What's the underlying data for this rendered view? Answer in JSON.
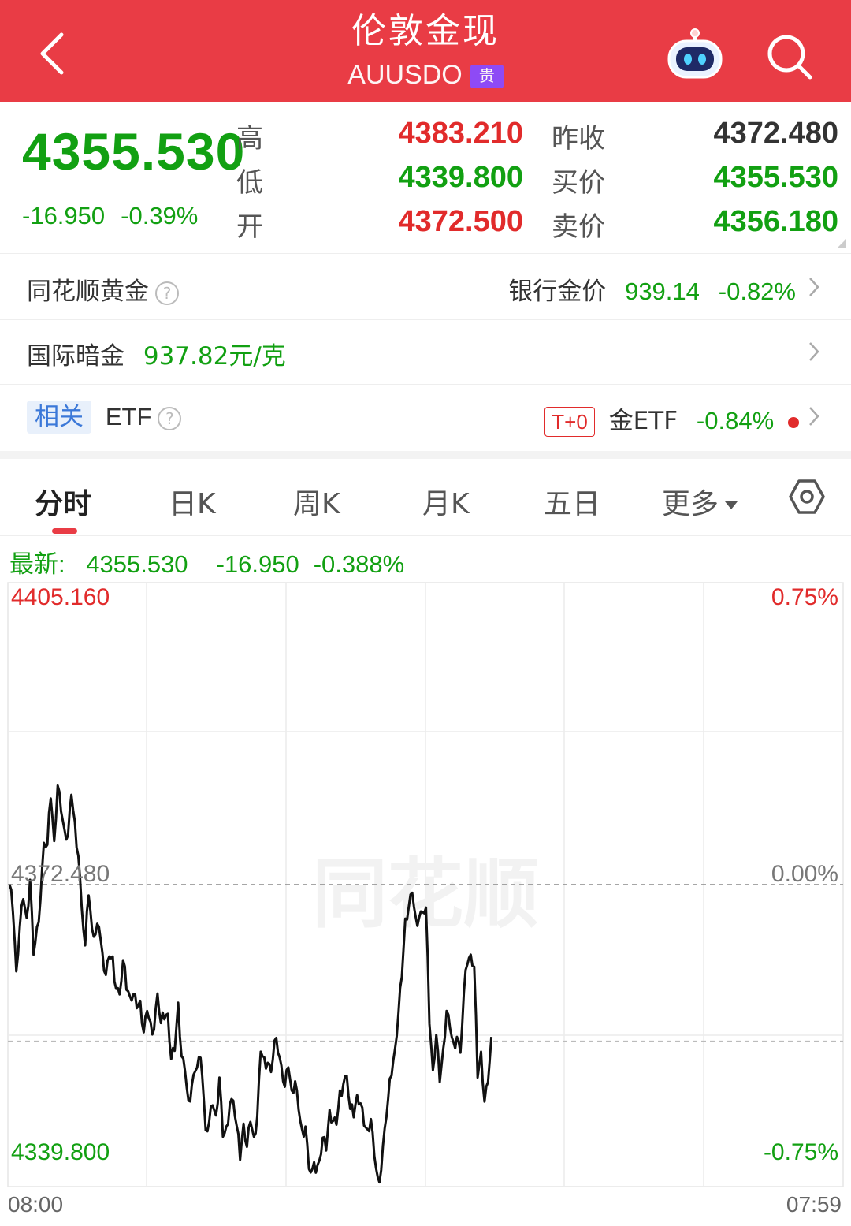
{
  "header": {
    "title": "伦敦金现",
    "code": "AUUSDO",
    "badge": "贵"
  },
  "quote": {
    "price": "4355.530",
    "change": "-16.950",
    "change_pct": "-0.39%",
    "high_label": "高",
    "high": "4383.210",
    "low_label": "低",
    "low": "4339.800",
    "open_label": "开",
    "open": "4372.500",
    "prev_close_label": "昨收",
    "prev_close": "4372.480",
    "bid_label": "买价",
    "bid": "4355.530",
    "ask_label": "卖价",
    "ask": "4356.180"
  },
  "rows": {
    "ths_gold_label": "同花顺黄金",
    "bank_gold_label": "银行金价",
    "bank_gold_price": "939.14",
    "bank_gold_change": "-0.82%",
    "intl_label": "国际暗金",
    "intl_price": "937.82元/克",
    "related_tag": "相关",
    "etf_label": "ETF",
    "t0_tag": "T+0",
    "gold_etf_label": "金ETF",
    "gold_etf_change": "-0.84%"
  },
  "tabs": [
    "分时",
    "日K",
    "周K",
    "月K",
    "五日",
    "更多"
  ],
  "chart_data": {
    "type": "line",
    "latest_label": "最新:",
    "latest_price": "4355.530",
    "latest_change": "-16.950",
    "latest_pct": "-0.388%",
    "y_top": "4405.160",
    "y_mid": "4372.480",
    "y_bottom": "4339.800",
    "pct_top": "0.75%",
    "pct_mid": "0.00%",
    "pct_bottom": "-0.75%",
    "x_start": "08:00",
    "x_end": "07:59",
    "ylim": [
      4339.8,
      4405.16
    ],
    "baseline": 4372.48,
    "current": 4355.53,
    "watermark": "同花顺",
    "line_color": "#111111",
    "x": [
      0,
      1,
      2,
      3,
      4,
      5,
      6,
      7,
      8,
      9,
      10,
      11,
      12,
      13,
      14,
      15,
      16,
      17,
      18,
      19,
      20,
      21,
      22,
      23,
      24,
      25,
      26,
      27,
      28,
      29,
      30,
      31,
      32,
      33,
      34,
      35,
      36,
      37,
      38,
      39,
      40,
      41,
      42,
      43,
      44,
      45,
      46,
      47,
      48,
      49,
      50,
      51,
      52,
      53,
      54,
      55,
      56,
      57,
      58,
      59,
      60,
      61,
      62,
      63,
      64,
      65,
      66,
      67,
      68,
      69,
      70,
      71,
      72,
      73,
      74,
      75,
      76,
      77,
      78,
      79,
      80,
      81,
      82,
      83,
      84,
      85,
      86,
      87,
      88,
      89,
      90,
      91,
      92,
      93,
      94,
      95,
      96,
      97,
      98,
      99,
      100,
      101,
      102,
      103,
      104,
      105,
      106,
      107,
      108,
      109,
      110,
      111,
      112,
      113,
      114,
      115,
      116,
      117,
      118,
      119,
      120,
      121,
      122,
      123,
      124,
      125,
      126,
      127,
      128,
      129,
      130,
      131,
      132,
      133,
      134,
      135,
      136,
      137,
      138,
      139,
      140,
      141,
      142,
      143,
      144,
      145,
      146,
      147,
      148,
      149,
      150,
      151,
      152,
      153,
      154,
      155,
      156,
      157,
      158,
      159,
      160,
      161,
      162,
      163,
      164,
      165,
      166,
      167,
      168,
      169,
      170,
      171,
      172,
      173,
      174,
      175
    ],
    "values": [
      4372.5,
      4369.5,
      4363.1,
      4367.9,
      4370.9,
      4368.9,
      4373.0,
      4364.9,
      4367.9,
      4370.8,
      4377.0,
      4376.8,
      4381.8,
      4377.2,
      4383.2,
      4380.4,
      4378.4,
      4377.8,
      4382.2,
      4379.3,
      4375.6,
      4370.0,
      4365.9,
      4371.3,
      4367.7,
      4367.1,
      4367.9,
      4365.1,
      4362.7,
      4364.7,
      4364.7,
      4361.2,
      4360.6,
      4364.3,
      4361.1,
      4360.4,
      4360.6,
      4359.1,
      4359.9,
      4356.5,
      4358.8,
      4357.6,
      4356.8,
      4360.7,
      4357.5,
      4357.9,
      4358.5,
      4353.6,
      4354.5,
      4359.7,
      4353.9,
      4352.3,
      4349.1,
      4350.8,
      4352.3,
      4353.8,
      4351.8,
      4345.9,
      4346.8,
      4348.6,
      4347.5,
      4351.6,
      4345.2,
      4346.3,
      4348.7,
      4349.1,
      4346.4,
      4342.7,
      4346.6,
      4344.1,
      4346.8,
      4345.2,
      4347.4,
      4354.4,
      4353.8,
      4353.2,
      4352.2,
      4355.6,
      4354.3,
      4352.9,
      4350.6,
      4352.7,
      4350.2,
      4351.2,
      4348.1,
      4346.0,
      4346.3,
      4341.7,
      4341.7,
      4341.3,
      4342.6,
      4345.1,
      4343.7,
      4348.1,
      4346.9,
      4346.5,
      4350.2,
      4350.9,
      4351.8,
      4348.2,
      4347.3,
      4349.7,
      4348.8,
      4346.4,
      4346.0,
      4347.1,
      4343.1,
      4340.8,
      4341.6,
      4346.1,
      4349.3,
      4351.8,
      4354.7,
      4358.6,
      4362.5,
      4368.8,
      4370.1,
      4371.6,
      4369.0,
      4368.9,
      4369.5,
      4370.0,
      4357.4,
      4352.4,
      4356.2,
      4351.1,
      4354.7,
      4358.8,
      4356.9,
      4355.4,
      4356.0,
      4354.3,
      4360.8,
      4363.8,
      4364.9,
      4363.6,
      4351.6,
      4354.4,
      4349.0,
      4351.1,
      4356.0
    ],
    "fine": true
  }
}
